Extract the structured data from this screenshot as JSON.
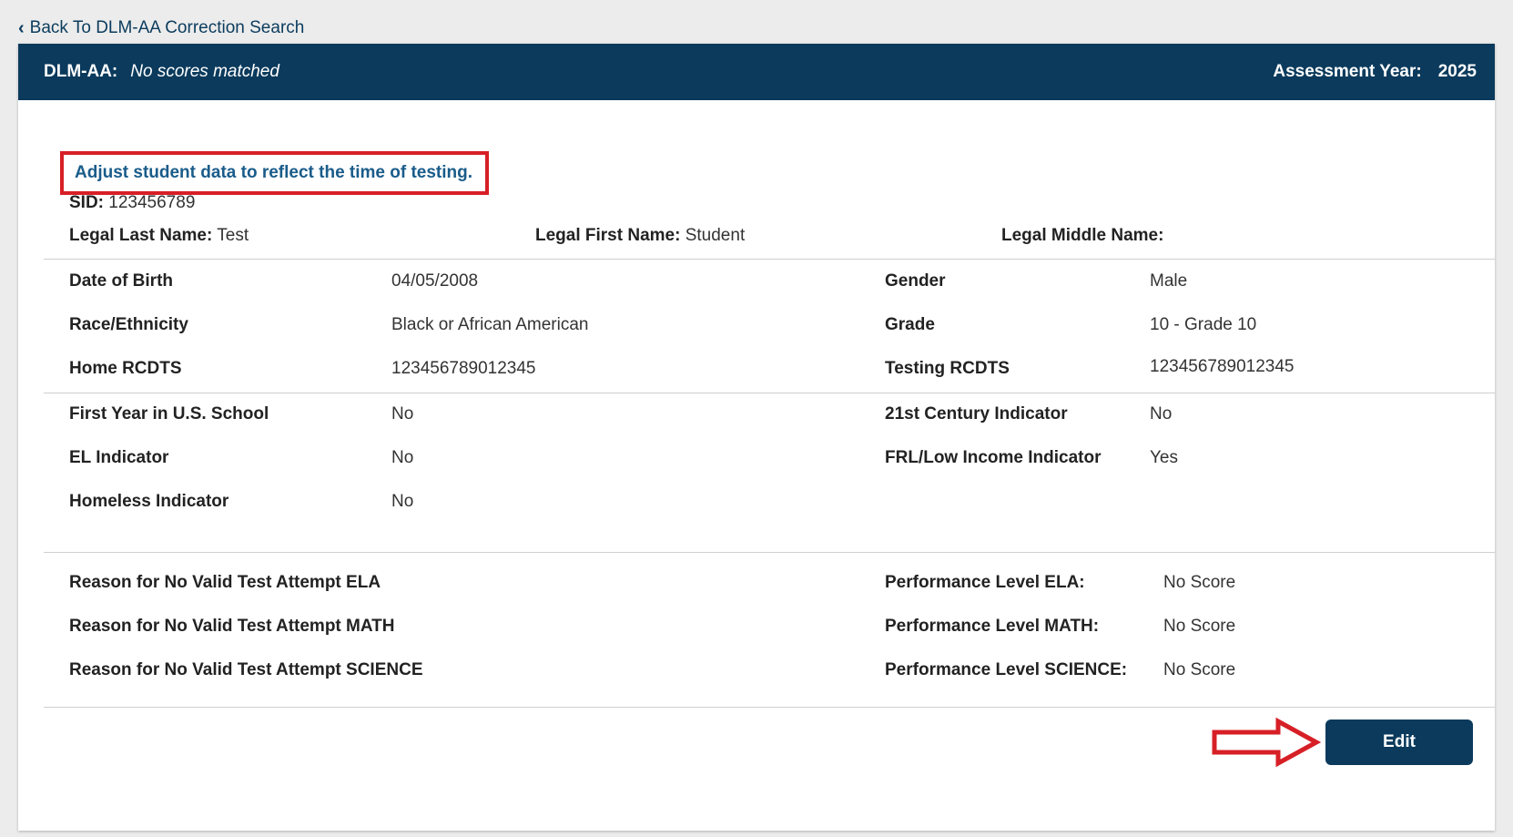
{
  "nav": {
    "back_label": "Back To DLM-AA Correction Search"
  },
  "header": {
    "program": "DLM-AA:",
    "status": "No scores matched",
    "year_label": "Assessment Year:",
    "year": "2025"
  },
  "instruction": "Adjust student data to reflect the time of testing.",
  "student": {
    "sid_label": "SID:",
    "sid": "123456789",
    "last_label": "Legal Last Name:",
    "last": "Test",
    "first_label": "Legal First Name:",
    "first": "Student",
    "middle_label": "Legal Middle Name:",
    "middle": ""
  },
  "fields": {
    "dob_label": "Date of Birth",
    "dob": "04/05/2008",
    "gender_label": "Gender",
    "gender": "Male",
    "race_label": "Race/Ethnicity",
    "race": "Black or African American",
    "grade_label": "Grade",
    "grade": "10 - Grade 10",
    "home_label": "Home RCDTS",
    "home": "123456789012345",
    "testing_label": "Testing RCDTS",
    "testing": "123456789012345",
    "firstyear_label": "First Year in U.S. School",
    "firstyear": "No",
    "century_label": "21st Century Indicator",
    "century": "No",
    "el_label": "EL Indicator",
    "el": "No",
    "frl_label": "FRL/Low Income Indicator",
    "frl": "Yes",
    "homeless_label": "Homeless Indicator",
    "homeless": "No"
  },
  "scores": {
    "ela_reason": "Reason for No Valid Test Attempt ELA",
    "math_reason": "Reason for No Valid Test Attempt MATH",
    "sci_reason": "Reason for No Valid Test Attempt SCIENCE",
    "ela_perf_label": "Performance Level ELA:",
    "ela_perf": "No Score",
    "math_perf_label": "Performance Level MATH:",
    "math_perf": "No Score",
    "sci_perf_label": "Performance Level SCIENCE:",
    "sci_perf": "No Score"
  },
  "actions": {
    "edit_label": "Edit"
  },
  "colors": {
    "header_bg": "#0b3a5c",
    "highlight_red": "#d71f26",
    "instruction_blue": "#1a5c8a"
  },
  "icons": {
    "back": "chevron-left-icon",
    "pointer": "right-arrow-icon"
  }
}
